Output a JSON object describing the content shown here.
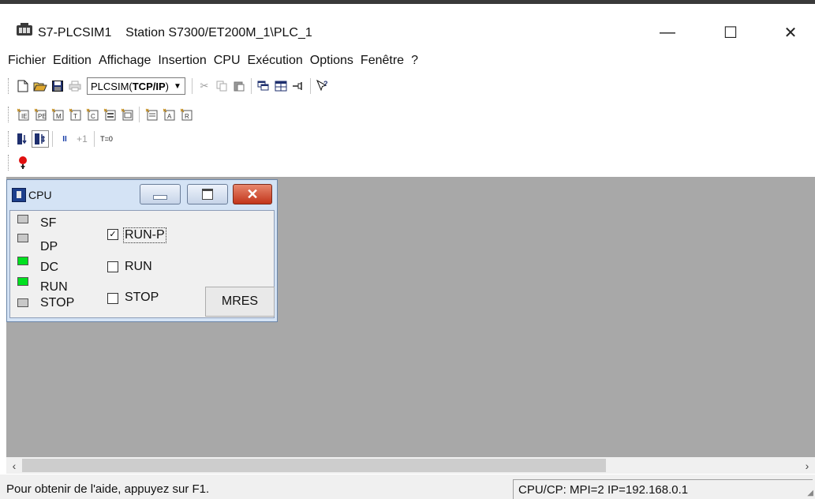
{
  "window": {
    "title": "S7-PLCSIM1    Station S7300/ET200M_1\\PLC_1",
    "minimize_glyph": "—",
    "maximize_glyph": "☐",
    "close_glyph": "✕"
  },
  "menu": [
    "Fichier",
    "Edition",
    "Affichage",
    "Insertion",
    "CPU",
    "Exécution",
    "Options",
    "Fenêtre",
    "?"
  ],
  "toolbar1": {
    "combo_prefix": "PLCSIM(",
    "combo_bold": "TCP/IP",
    "combo_suffix": ")",
    "icons": [
      "new-icon",
      "open-icon",
      "save-icon",
      "print-icon",
      "cut-icon",
      "copy-icon",
      "paste-icon",
      "cascade-icon",
      "tile-icon",
      "pin-icon",
      "context-help-icon"
    ]
  },
  "toolbar3": {
    "pause_label": "II",
    "step_label": "+1",
    "reset_time_label": "T=0"
  },
  "cpu_window": {
    "title": "CPU",
    "leds": [
      {
        "label": "SF",
        "color": "grey"
      },
      {
        "label": "DP",
        "color": "grey"
      },
      {
        "label": "DC",
        "color": "green"
      },
      {
        "label": "RUN",
        "color": "green"
      },
      {
        "label": "STOP",
        "color": "grey"
      }
    ],
    "modes": [
      {
        "label": "RUN-P",
        "checked": true
      },
      {
        "label": "RUN",
        "checked": false
      },
      {
        "label": "STOP",
        "checked": false
      }
    ],
    "mres_label": "MRES"
  },
  "colors": {
    "workspace": "#a8a8a8",
    "led_green": "#00e020",
    "led_grey": "#c8c8c8",
    "close_red": "#c2351b"
  },
  "statusbar": {
    "help_text": "Pour obtenir de l'aide, appuyez sur F1.",
    "connection": "CPU/CP:  MPI=2 IP=192.168.0.1"
  }
}
